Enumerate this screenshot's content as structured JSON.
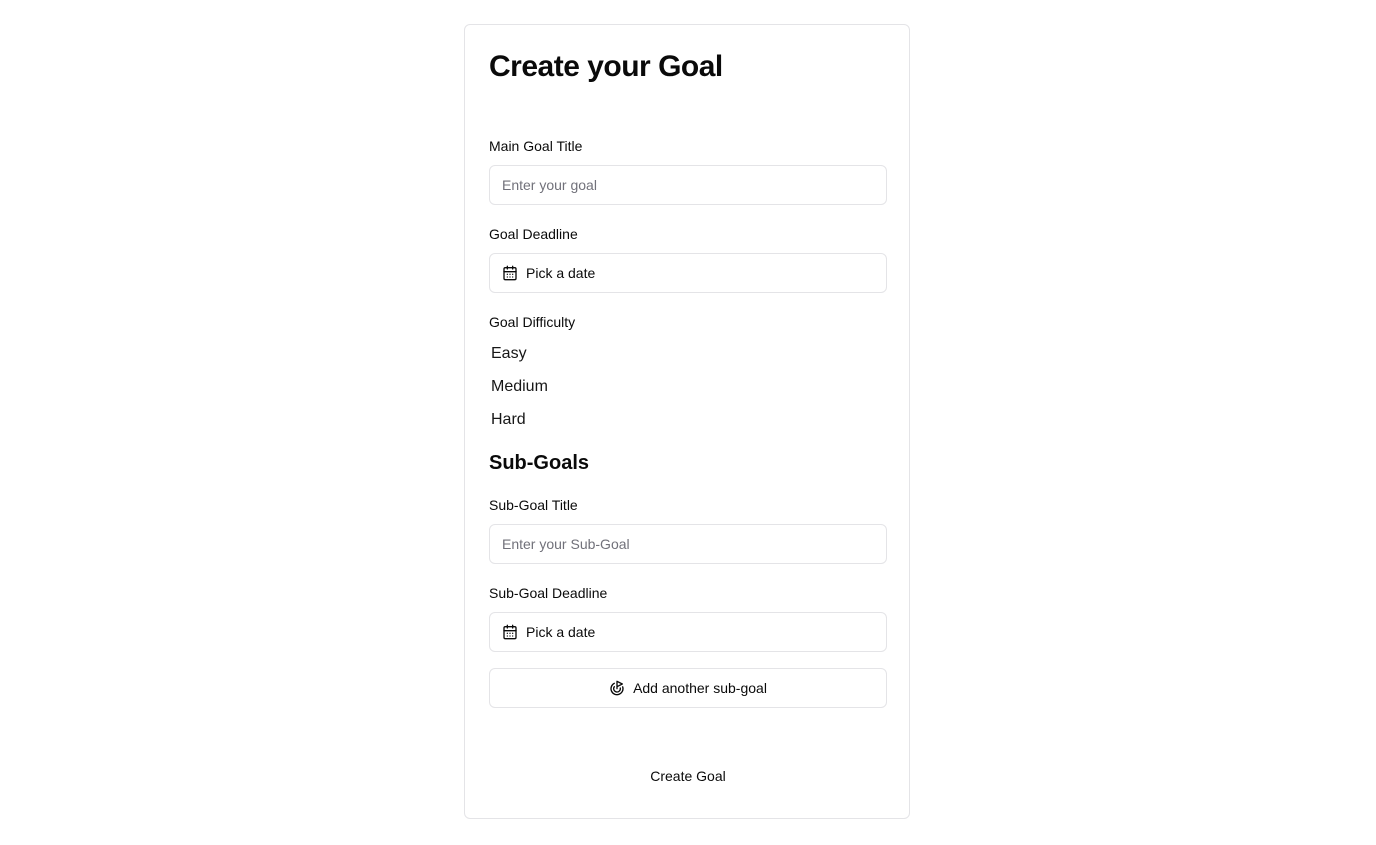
{
  "form": {
    "title": "Create your Goal",
    "main_goal": {
      "label": "Main Goal Title",
      "placeholder": "Enter your goal",
      "value": ""
    },
    "goal_deadline": {
      "label": "Goal Deadline",
      "button_text": "Pick a date",
      "icon": "calendar-icon"
    },
    "difficulty": {
      "label": "Goal Difficulty",
      "options": [
        "Easy",
        "Medium",
        "Hard"
      ]
    },
    "subgoals": {
      "heading": "Sub-Goals",
      "title_label": "Sub-Goal Title",
      "title_placeholder": "Enter your Sub-Goal",
      "title_value": "",
      "deadline_label": "Sub-Goal Deadline",
      "deadline_button_text": "Pick a date",
      "deadline_icon": "calendar-icon",
      "add_button_text": "Add another sub-goal",
      "add_button_icon": "goal-target-icon"
    },
    "submit_text": "Create Goal"
  },
  "colors": {
    "border": "#e4e4e7",
    "text": "#0a0a0a",
    "placeholder": "#71717a",
    "background": "#ffffff"
  }
}
